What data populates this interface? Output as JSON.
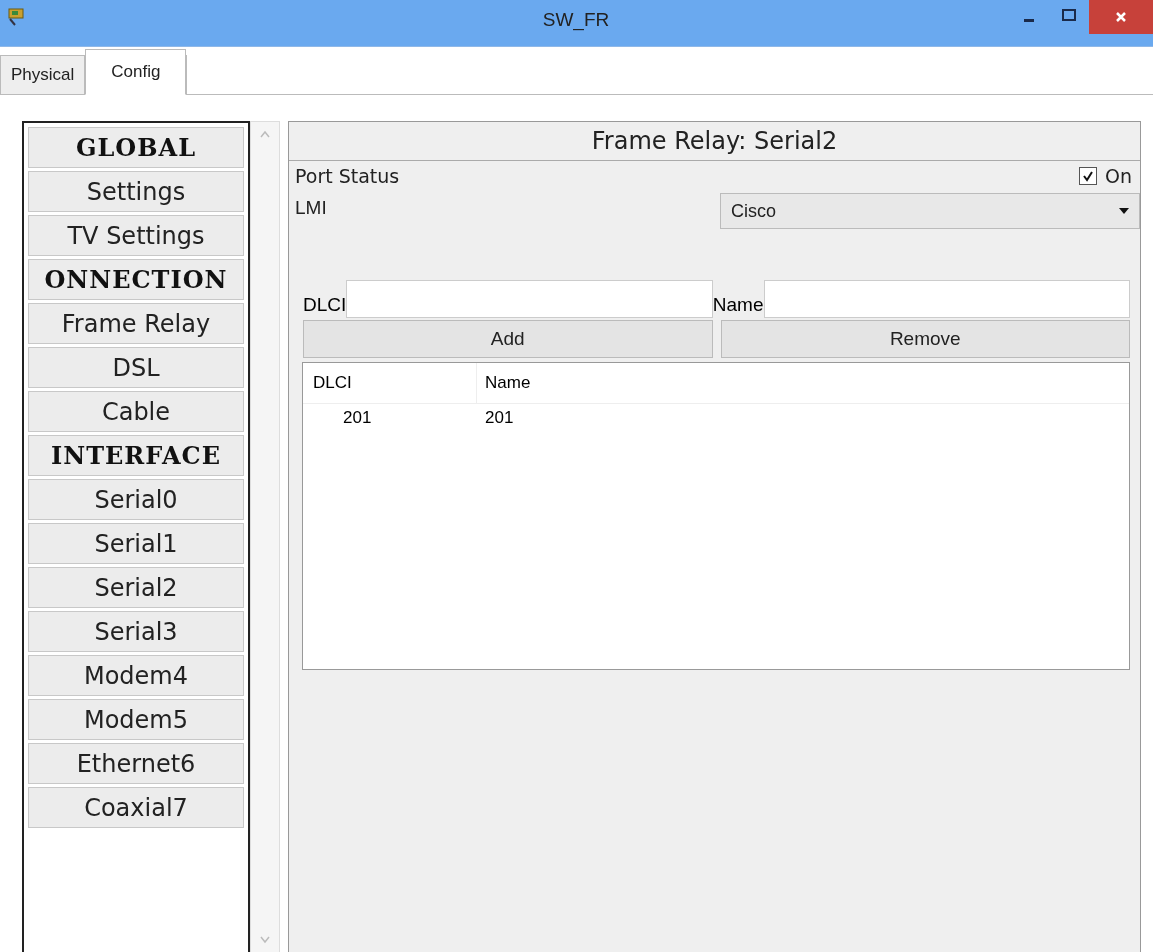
{
  "window": {
    "title": "SW_FR"
  },
  "tabs": [
    {
      "label": "Physical",
      "selected": false
    },
    {
      "label": "Config",
      "selected": true
    }
  ],
  "sidebar": {
    "items": [
      {
        "kind": "header",
        "label": "GLOBAL"
      },
      {
        "kind": "item",
        "label": "Settings"
      },
      {
        "kind": "item",
        "label": "TV Settings"
      },
      {
        "kind": "header",
        "label": "ONNECTION"
      },
      {
        "kind": "item",
        "label": "Frame Relay"
      },
      {
        "kind": "item",
        "label": "DSL"
      },
      {
        "kind": "item",
        "label": "Cable"
      },
      {
        "kind": "header",
        "label": "INTERFACE"
      },
      {
        "kind": "item",
        "label": "Serial0"
      },
      {
        "kind": "item",
        "label": "Serial1"
      },
      {
        "kind": "item",
        "label": "Serial2"
      },
      {
        "kind": "item",
        "label": "Serial3"
      },
      {
        "kind": "item",
        "label": "Modem4"
      },
      {
        "kind": "item",
        "label": "Modem5"
      },
      {
        "kind": "item",
        "label": "Ethernet6"
      },
      {
        "kind": "item",
        "label": "Coaxial7"
      }
    ]
  },
  "panel": {
    "title": "Frame Relay: Serial2",
    "port_status": {
      "label": "Port Status",
      "checkbox_label": "On",
      "checked": true
    },
    "lmi": {
      "label": "LMI",
      "value": "Cisco"
    },
    "dlci_field": {
      "label": "DLCI"
    },
    "name_field": {
      "label": "Name"
    },
    "buttons": [
      "Add",
      "Remove"
    ],
    "table": {
      "columns": [
        "DLCI",
        "Name"
      ],
      "rows": [
        [
          "201",
          "201"
        ]
      ]
    }
  }
}
